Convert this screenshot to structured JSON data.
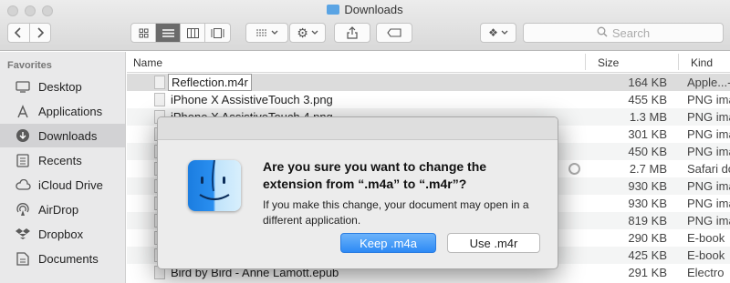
{
  "window": {
    "title": "Downloads"
  },
  "toolbar": {
    "back_icon": "chevron-left",
    "forward_icon": "chevron-right",
    "search_placeholder": "Search"
  },
  "sidebar": {
    "section": "Favorites",
    "items": [
      {
        "label": "Desktop",
        "icon": "desktop-icon"
      },
      {
        "label": "Applications",
        "icon": "applications-icon"
      },
      {
        "label": "Downloads",
        "icon": "downloads-icon",
        "active": true
      },
      {
        "label": "Recents",
        "icon": "recents-icon"
      },
      {
        "label": "iCloud Drive",
        "icon": "cloud-icon"
      },
      {
        "label": "AirDrop",
        "icon": "airdrop-icon"
      },
      {
        "label": "Dropbox",
        "icon": "dropbox-icon"
      },
      {
        "label": "Documents",
        "icon": "documents-icon"
      }
    ]
  },
  "list": {
    "columns": {
      "name": "Name",
      "size": "Size",
      "kind": "Kind"
    },
    "rows": [
      {
        "name": "Reflection.m4r",
        "size": "164 KB",
        "kind": "Apple...-"
      },
      {
        "name": "iPhone X AssistiveTouch 3.png",
        "size": "455 KB",
        "kind": "PNG ima"
      },
      {
        "name": "iPhone X AssistiveTouch 4.png",
        "size": "1.3 MB",
        "kind": "PNG ima"
      },
      {
        "name": "",
        "size": "301 KB",
        "kind": "PNG ima"
      },
      {
        "name": "",
        "size": "450 KB",
        "kind": "PNG ima"
      },
      {
        "name": "",
        "size": "2.7 MB",
        "kind": "Safari do"
      },
      {
        "name": "",
        "size": "930 KB",
        "kind": "PNG ima"
      },
      {
        "name": "",
        "size": "930 KB",
        "kind": "PNG ima"
      },
      {
        "name": "",
        "size": "819 KB",
        "kind": "PNG ima"
      },
      {
        "name": "",
        "size": "290 KB",
        "kind": "E-book"
      },
      {
        "name": "",
        "size": "425 KB",
        "kind": "E-book"
      },
      {
        "name": "Bird by Bird - Anne Lamott.epub",
        "size": "291 KB",
        "kind": "Electro"
      }
    ]
  },
  "dialog": {
    "title": "Are you sure you want to change the extension from “.m4a” to “.m4r”?",
    "body": "If you make this change, your document may open in a different application.",
    "primary_button": "Keep .m4a",
    "secondary_button": "Use .m4r",
    "icon": "finder-icon"
  }
}
